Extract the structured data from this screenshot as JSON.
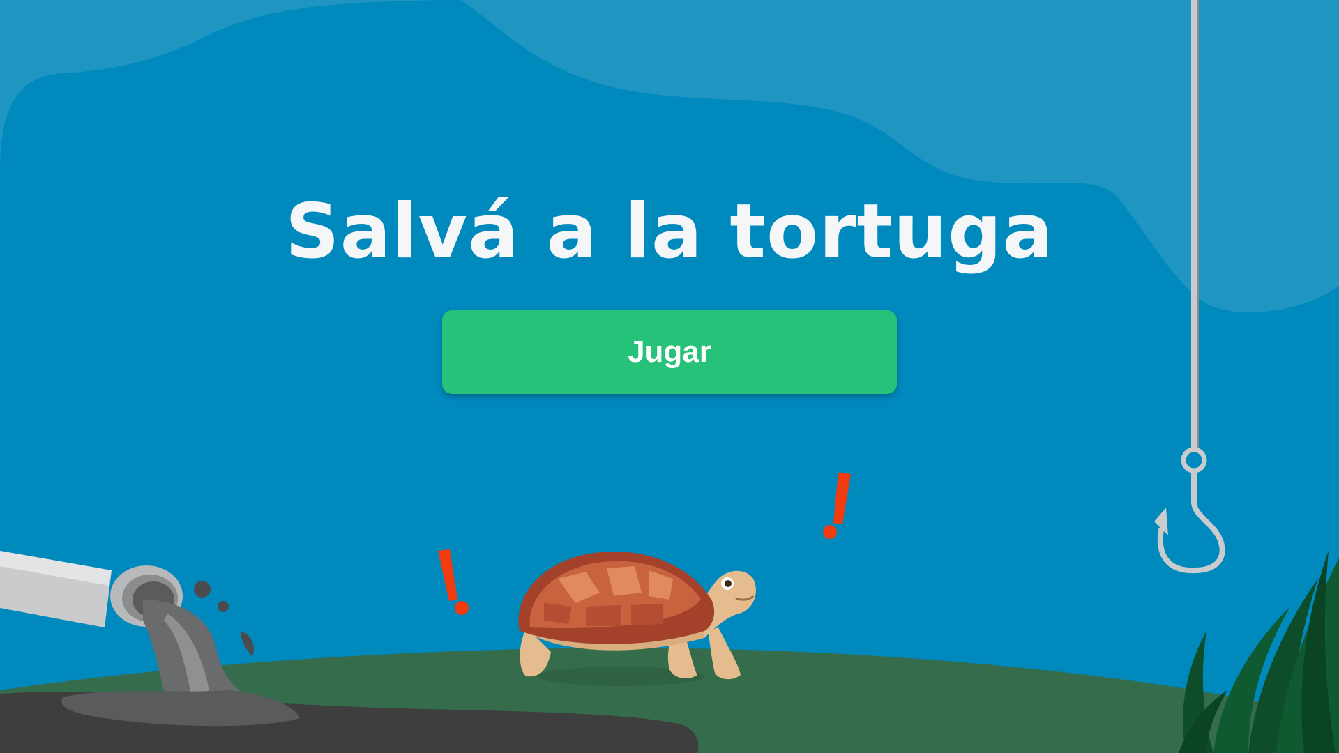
{
  "game": {
    "title": "Salvá a la tortuga",
    "play_button_label": "Jugar"
  },
  "colors": {
    "water": "#0089bd",
    "water_light": "#1f96c2",
    "seabed": "#356d4c",
    "oil": "#3e3e3f",
    "button": "#27c27a",
    "alert": "#f23b0f"
  },
  "icons": {
    "turtle": "turtle-icon",
    "fishing_hook": "fishing-hook-icon",
    "pipe": "pipe-icon",
    "alert_left": "exclamation-icon",
    "alert_right": "exclamation-icon",
    "seaweed": "seaweed-icon"
  }
}
